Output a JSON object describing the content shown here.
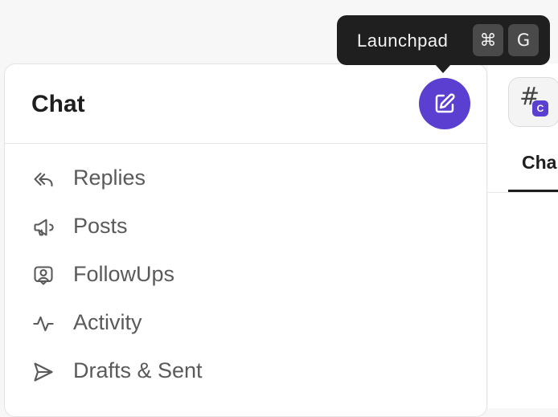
{
  "panel": {
    "title": "Chat",
    "compose_icon": "compose-icon"
  },
  "nav": {
    "items": [
      {
        "label": "Replies",
        "icon": "reply-icon"
      },
      {
        "label": "Posts",
        "icon": "megaphone-icon"
      },
      {
        "label": "FollowUps",
        "icon": "followup-icon"
      },
      {
        "label": "Activity",
        "icon": "activity-icon"
      },
      {
        "label": "Drafts & Sent",
        "icon": "send-icon"
      }
    ]
  },
  "tooltip": {
    "text": "Launchpad",
    "keys": [
      "⌘",
      "G"
    ]
  },
  "right_pane": {
    "channel_glyph": "#",
    "badge": "C",
    "tab_label": "Cha"
  },
  "colors": {
    "accent": "#5b3fd0",
    "tooltip_bg": "#1f1f1f"
  }
}
